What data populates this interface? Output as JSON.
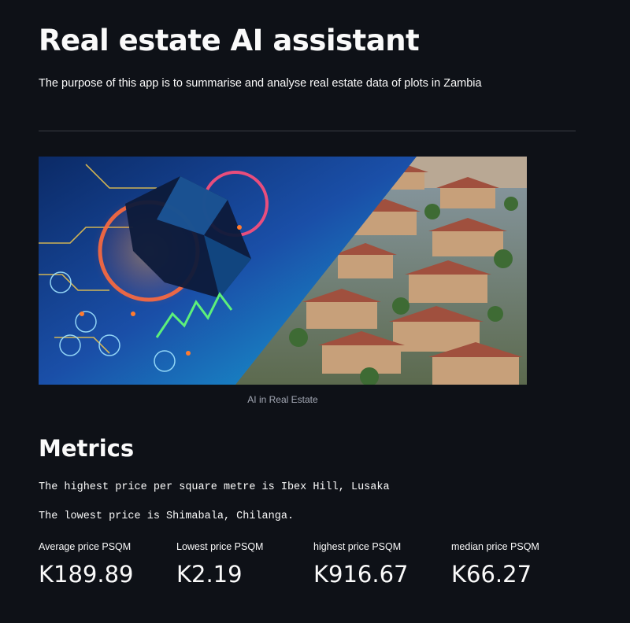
{
  "header": {
    "title": "Real estate AI assistant",
    "subtitle": "The purpose of this app is to summarise and analyse real estate data of plots in Zambia"
  },
  "hero_image": {
    "caption": "AI in Real Estate"
  },
  "metrics_section": {
    "title": "Metrics",
    "highest_text": "The highest price per square metre is Ibex Hill, Lusaka",
    "lowest_text": "The lowest price is Shimabala, Chilanga.",
    "items": [
      {
        "label": "Average price PSQM",
        "value": "K189.89"
      },
      {
        "label": "Lowest price PSQM",
        "value": "K2.19"
      },
      {
        "label": "highest price PSQM",
        "value": "K916.67"
      },
      {
        "label": "median price PSQM",
        "value": "K66.27"
      }
    ]
  },
  "colors": {
    "background": "#0e1117",
    "text": "#fafafa",
    "caption": "#a3a8b4",
    "divider": "#3a3d45"
  }
}
